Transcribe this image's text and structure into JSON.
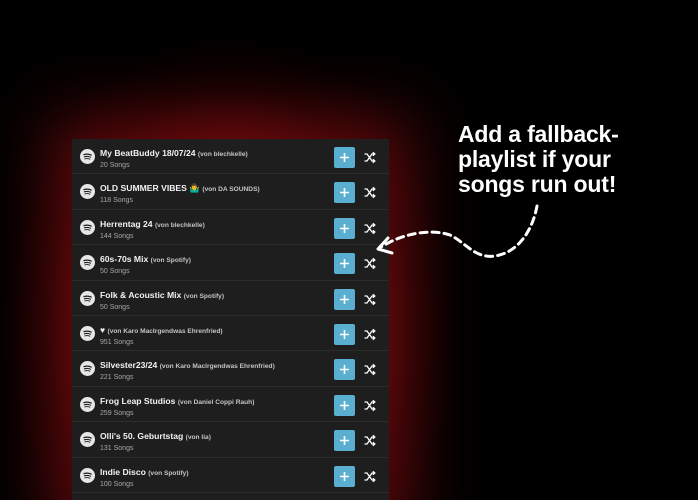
{
  "annotation": {
    "line1": "Add a fallback-",
    "line2": "playlist if your",
    "line3": "songs run out!"
  },
  "playlists": [
    {
      "title": "My BeatBuddy 18/07/24",
      "owner": "(von blechkelle)",
      "count": "20 Songs"
    },
    {
      "title": "OLD SUMMER VIBES 🤷‍♂️",
      "owner": "(von DA SOUNDS)",
      "count": "118 Songs"
    },
    {
      "title": "Herrentag 24",
      "owner": "(von blechkelle)",
      "count": "144 Songs"
    },
    {
      "title": "60s-70s Mix",
      "owner": "(von Spotify)",
      "count": "50 Songs"
    },
    {
      "title": "Folk & Acoustic Mix",
      "owner": "(von Spotify)",
      "count": "50 Songs"
    },
    {
      "title": "♥",
      "owner": "(von Karo MacIrgendwas Ehrenfried)",
      "count": "951 Songs"
    },
    {
      "title": "Silvester23/24",
      "owner": "(von Karo MacIrgendwas Ehrenfried)",
      "count": "221 Songs"
    },
    {
      "title": "Frog Leap Studios",
      "owner": "(von Daniel Coppi Rauh)",
      "count": "259 Songs"
    },
    {
      "title": "Olli's 50. Geburtstag",
      "owner": "(von lia)",
      "count": "131 Songs"
    },
    {
      "title": "Indie Disco",
      "owner": "(von Spotify)",
      "count": "100 Songs"
    }
  ],
  "icons": {
    "row_source": "spotify-icon",
    "add": "plus-icon",
    "shuffle": "shuffle-icon"
  },
  "colors": {
    "background": "#000000",
    "glow": "#8c0c10",
    "panel": "#1e1e1e",
    "add_button": "#5aaecf",
    "text": "#f2f2f2"
  }
}
